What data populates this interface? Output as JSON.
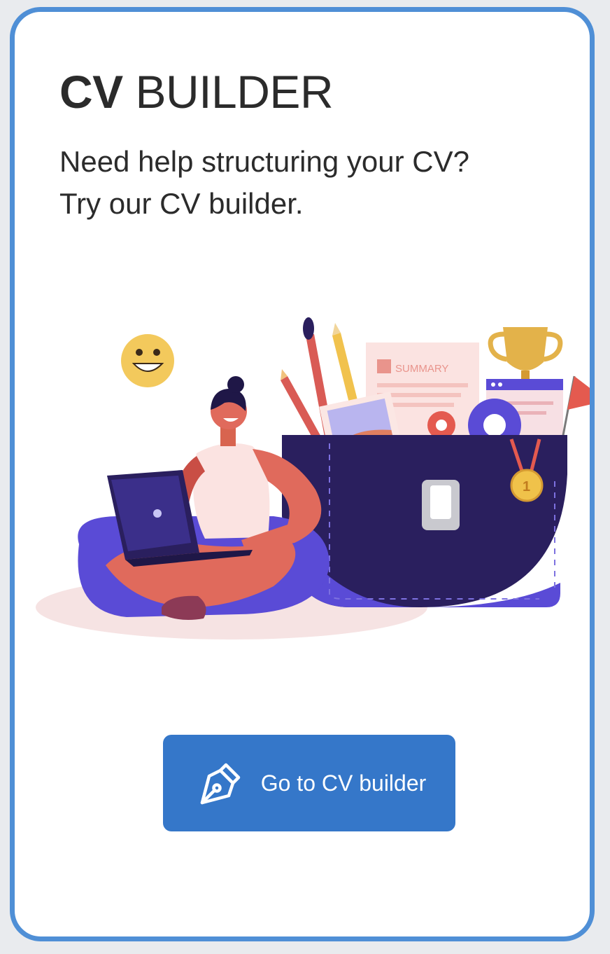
{
  "card": {
    "title_bold": "CV",
    "title_rest": "BUILDER",
    "subtitle_line1": "Need help structuring your CV?",
    "subtitle_line2": "Try our CV builder.",
    "illustration": {
      "icon": "woman-with-laptop-and-briefcase-illustration",
      "summary_label": "SUMMARY",
      "medal_label": "1"
    },
    "button": {
      "label": "Go to CV builder",
      "icon": "pen-nib-icon"
    }
  },
  "colors": {
    "card_border": "#4f8fd6",
    "button_bg": "#3577c9",
    "text": "#2b2b2b",
    "navy": "#2a1f5e",
    "purple": "#5a4bd6",
    "coral": "#e06a5c",
    "gold": "#f0c24a"
  }
}
